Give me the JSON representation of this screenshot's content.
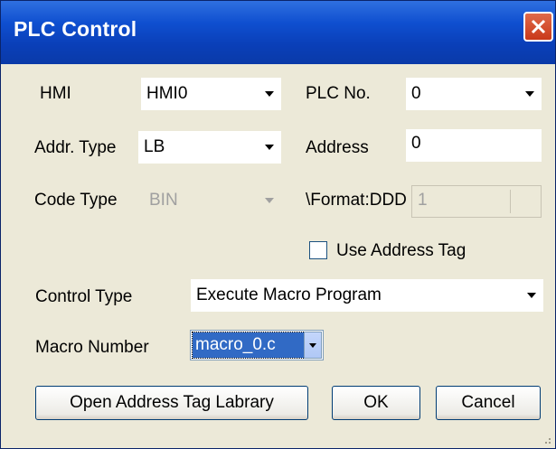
{
  "window": {
    "title": "PLC Control"
  },
  "form": {
    "hmi": {
      "label": "HMI",
      "value": "HMI0"
    },
    "plc_no": {
      "label": "PLC No.",
      "value": "0"
    },
    "addr_type": {
      "label": "Addr. Type",
      "value": "LB"
    },
    "address": {
      "label": "Address",
      "value": "0"
    },
    "code_type": {
      "label": "Code Type",
      "value": "BIN"
    },
    "format": {
      "label": "\\Format:DDD",
      "value": "1"
    },
    "use_address_tag": {
      "label": "Use Address Tag",
      "checked": false
    },
    "control_type": {
      "label": "Control Type",
      "value": "Execute Macro Program"
    },
    "macro_number": {
      "label": "Macro Number",
      "value": "macro_0.c"
    }
  },
  "buttons": {
    "open_tag_library": "Open Address Tag Labrary",
    "ok": "OK",
    "cancel": "Cancel"
  }
}
